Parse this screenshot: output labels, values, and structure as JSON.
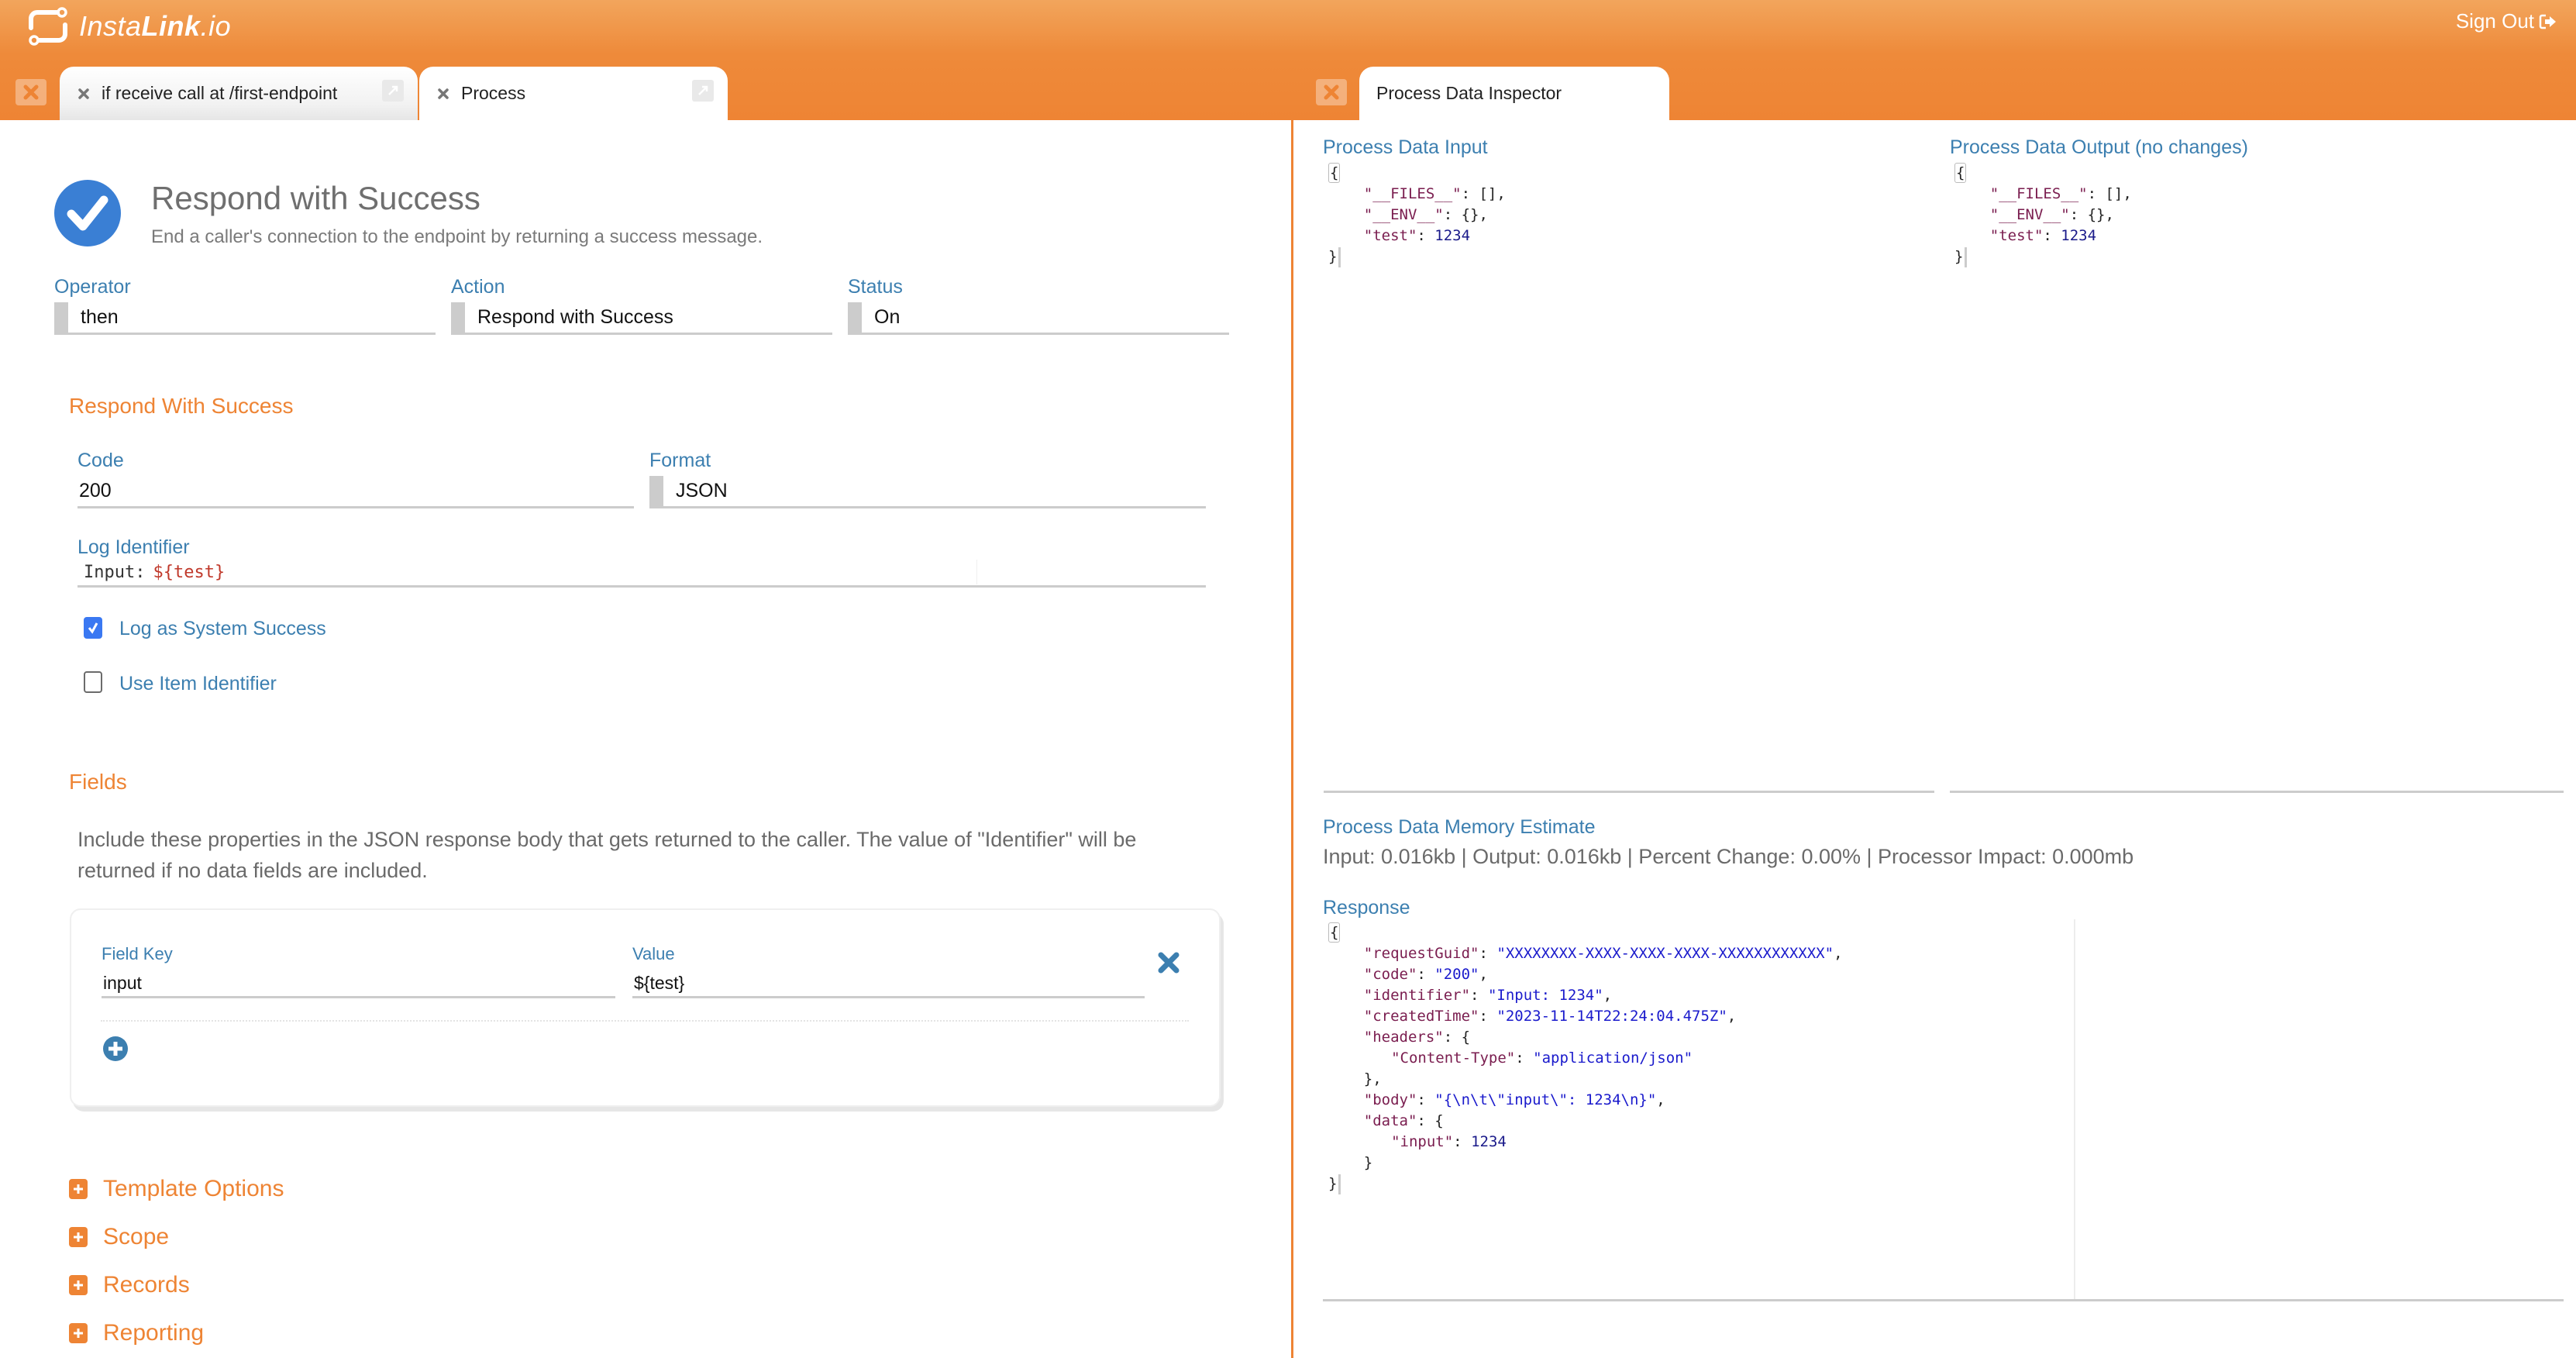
{
  "header": {
    "logo": {
      "text_light": "Insta",
      "text_bold": "Link",
      "text_suffix": ".io"
    },
    "sign_out_label": "Sign Out"
  },
  "left_tabs": [
    {
      "label": "if receive call at /first-endpoint",
      "active": false
    },
    {
      "label": "Process",
      "active": true
    }
  ],
  "right_tabs": [
    {
      "label": "Process Data Inspector",
      "active": true
    }
  ],
  "action": {
    "title": "Respond with Success",
    "subtitle": "End a caller's connection to the endpoint by returning a success message.",
    "operator": {
      "label": "Operator",
      "value": "then"
    },
    "action_field": {
      "label": "Action",
      "value": "Respond with Success"
    },
    "status": {
      "label": "Status",
      "value": "On"
    }
  },
  "respond_section": {
    "heading": "Respond With Success",
    "code": {
      "label": "Code",
      "value": "200"
    },
    "format": {
      "label": "Format",
      "value": "JSON"
    },
    "log_identifier": {
      "label": "Log Identifier",
      "plain": "Input:",
      "variable": "${test}"
    },
    "log_as_system_success": {
      "label": "Log as System Success",
      "checked": true
    },
    "use_item_identifier": {
      "label": "Use Item Identifier",
      "checked": false
    }
  },
  "fields_section": {
    "heading": "Fields",
    "description": "Include these properties in the JSON response body that gets returned to the caller. The value of \"Identifier\" will be returned if no data fields are included.",
    "rows": [
      {
        "key_label": "Field Key",
        "key": "input",
        "value_label": "Value",
        "value": "${test}"
      }
    ]
  },
  "accordions": [
    {
      "label": "Template Options"
    },
    {
      "label": "Scope"
    },
    {
      "label": "Records"
    },
    {
      "label": "Reporting"
    }
  ],
  "inspector": {
    "input_title": "Process Data Input",
    "output_title": "Process Data Output (no changes)",
    "input_json": [
      {
        "key": "__FILES__",
        "value": "[]",
        "type": "raw",
        "comma": true
      },
      {
        "key": "__ENV__",
        "value": "{}",
        "type": "raw",
        "comma": true
      },
      {
        "key": "test",
        "value": "1234",
        "type": "number",
        "comma": false
      }
    ],
    "output_json": [
      {
        "key": "__FILES__",
        "value": "[]",
        "type": "raw",
        "comma": true
      },
      {
        "key": "__ENV__",
        "value": "{}",
        "type": "raw",
        "comma": true
      },
      {
        "key": "test",
        "value": "1234",
        "type": "number",
        "comma": false
      }
    ],
    "memory_title": "Process Data Memory Estimate",
    "memory_text": "Input: 0.016kb | Output: 0.016kb | Percent Change: 0.00% | Processor Impact: 0.000mb",
    "response_title": "Response",
    "response": {
      "requestGuid": "XXXXXXXX-XXXX-XXXX-XXXX-XXXXXXXXXXXX",
      "code": "200",
      "identifier": "Input: 1234",
      "createdTime": "2023-11-14T22:24:04.475Z",
      "headers_content_type": "application/json",
      "body": "{\\n\\t\\\"input\\\": 1234\\n}",
      "data_input": "1234"
    }
  },
  "colors": {
    "brand_orange": "#ee8434",
    "label_blue": "#3c7fb0",
    "check_blue": "#3a78f2"
  }
}
